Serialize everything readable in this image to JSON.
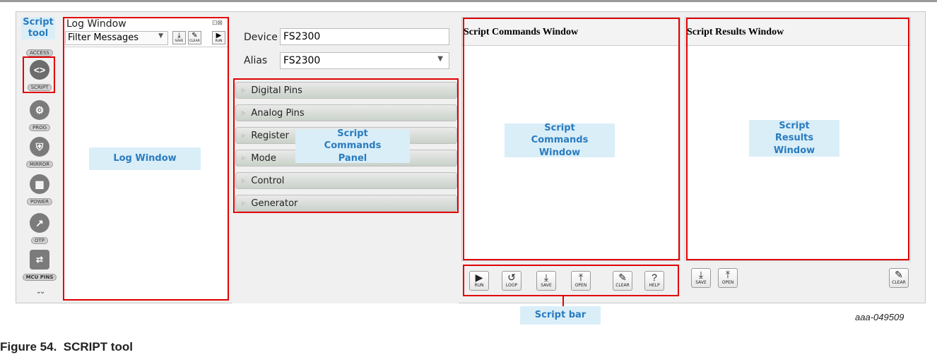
{
  "sidebar": {
    "title": "Script tool",
    "items": [
      {
        "label": "ACCESS",
        "icon": "access-icon",
        "glyph": ""
      },
      {
        "label": "SCRIPT",
        "icon": "script-code-icon",
        "glyph": "<>"
      },
      {
        "label": "PROG",
        "icon": "prog-gear-icon",
        "glyph": "⚙"
      },
      {
        "label": "MIRROR",
        "icon": "mirror-icon",
        "glyph": "⛨"
      },
      {
        "label": "POWER",
        "icon": "power-calculator-icon",
        "glyph": "▦"
      },
      {
        "label": "OTP",
        "icon": "otp-hammer-icon",
        "glyph": "↗"
      },
      {
        "label": "MCU PINS",
        "icon": "mcu-pins-icon",
        "glyph": "⇄"
      }
    ],
    "more_glyph": "⌄⌄"
  },
  "log_window": {
    "title": "Log Window",
    "filter_value": "Filter Messages",
    "buttons": [
      {
        "label": "SAVE",
        "glyph": "⤓"
      },
      {
        "label": "CLEAR",
        "glyph": "✎"
      },
      {
        "label": "RUN",
        "glyph": "▶"
      }
    ],
    "callout": "Log Window"
  },
  "device_panel": {
    "device_label": "Device",
    "device_value": "FS2300",
    "alias_label": "Alias",
    "alias_value": "FS2300"
  },
  "commands_panel": {
    "items": [
      "Digital Pins",
      "Analog Pins",
      "Register",
      "Mode",
      "Control",
      "Generator"
    ],
    "callout": "Script Commands Panel"
  },
  "commands_window": {
    "title": "Script Commands Window",
    "callout": "Script Commands Window"
  },
  "results_window": {
    "title": "Script Results Window",
    "callout": "Script Results Window"
  },
  "script_bar": {
    "buttons": [
      {
        "label": "RUN",
        "glyph": "▶"
      },
      {
        "label": "LOOP",
        "glyph": "↺"
      },
      {
        "label": "SAVE",
        "glyph": "⤓"
      },
      {
        "label": "OPEN",
        "glyph": "⤒"
      },
      {
        "label": "CLEAR",
        "glyph": "✎"
      },
      {
        "label": "HELP",
        "glyph": "?"
      }
    ],
    "callout": "Script bar"
  },
  "results_bar": {
    "buttons": [
      {
        "label": "SAVE",
        "glyph": "⤓"
      },
      {
        "label": "OPEN",
        "glyph": "⤒"
      },
      {
        "label": "CLEAR",
        "glyph": "✎"
      }
    ]
  },
  "figure": {
    "id": "aaa-049509",
    "caption": "Figure 54.  SCRIPT tool"
  },
  "colors": {
    "highlight_red": "#e00000",
    "callout_bg": "#daeef8",
    "callout_text": "#2a7cbf"
  }
}
